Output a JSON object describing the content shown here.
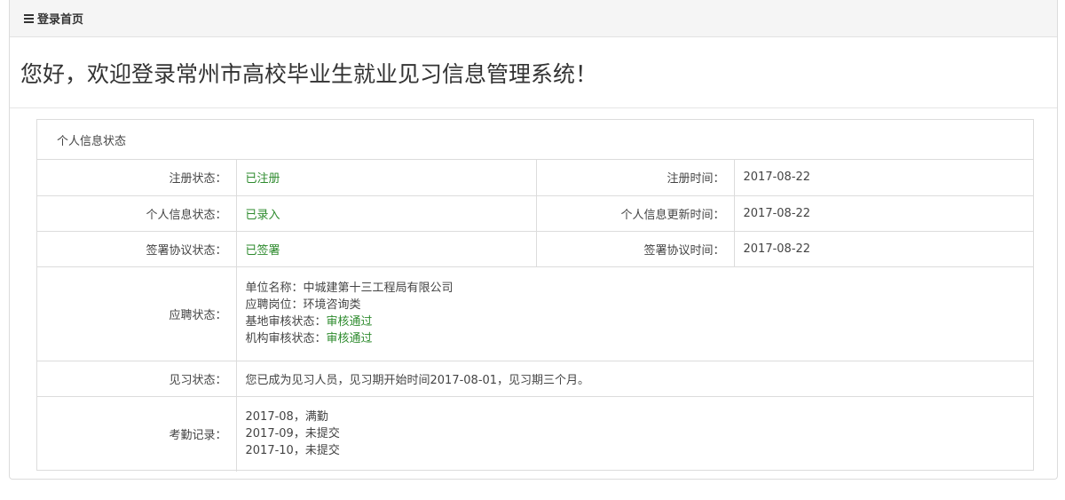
{
  "breadcrumb": {
    "icon": "menu-icon",
    "label": "登录首页"
  },
  "welcome": "您好，欢迎登录常州市高校毕业生就业见习信息管理系统！",
  "panel": {
    "title": "个人信息状态",
    "rows": [
      {
        "label": "注册状态：",
        "value": "已注册",
        "label2": "注册时间：",
        "value2": "2017-08-22"
      },
      {
        "label": "个人信息状态：",
        "value": "已录入",
        "label2": "个人信息更新时间：",
        "value2": "2017-08-22"
      },
      {
        "label": "签署协议状态：",
        "value": "已签署",
        "label2": "签署协议时间：",
        "value2": "2017-08-22"
      }
    ],
    "application": {
      "label": "应聘状态：",
      "company_prefix": "单位名称：",
      "company": "中城建第十三工程局有限公司",
      "position_prefix": "应聘岗位：",
      "position": "环境咨询类",
      "base_review_prefix": "基地审核状态：",
      "base_review": "审核通过",
      "org_review_prefix": "机构审核状态：",
      "org_review": "审核通过"
    },
    "internship": {
      "label": "见习状态：",
      "value": "您已成为见习人员，见习期开始时间2017-08-01，见习期三个月。"
    },
    "attendance": {
      "label": "考勤记录：",
      "records": [
        "2017-08，满勤",
        "2017-09，未提交",
        "2017-10，未提交"
      ]
    }
  },
  "colors": {
    "status_green": "#2e8b2e",
    "border": "#dcdcdc",
    "header_bg": "#f5f5f5"
  }
}
